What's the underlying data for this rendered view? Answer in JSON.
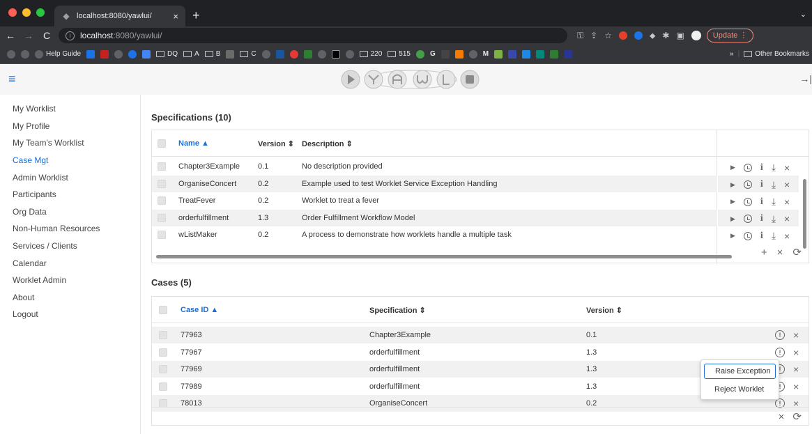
{
  "browser": {
    "tab_title": "localhost:8080/yawlui/",
    "tab_close": "×",
    "new_tab": "+",
    "url_host": "localhost",
    "url_path": ":8080/yawlui/",
    "update_label": "Update",
    "bookmarks": [
      {
        "label": "Help Guide",
        "kind": "site"
      },
      {
        "label": "DQ",
        "kind": "folder"
      },
      {
        "label": "A",
        "kind": "folder"
      },
      {
        "label": "B",
        "kind": "folder"
      },
      {
        "label": "C",
        "kind": "folder"
      },
      {
        "label": "220",
        "kind": "folder"
      },
      {
        "label": "515",
        "kind": "folder"
      },
      {
        "label": "G",
        "kind": "site"
      },
      {
        "label": "M",
        "kind": "site"
      }
    ],
    "bookmarks_overflow": "»",
    "other_bookmarks": "Other Bookmarks"
  },
  "sidebar": {
    "items": [
      {
        "label": "My Worklist",
        "active": false
      },
      {
        "label": "My Profile",
        "active": false
      },
      {
        "label": "My Team's Worklist",
        "active": false
      },
      {
        "label": "Case Mgt",
        "active": true
      },
      {
        "label": "Admin Worklist",
        "active": false
      },
      {
        "label": "Participants",
        "active": false
      },
      {
        "label": "Org Data",
        "active": false
      },
      {
        "label": "Non-Human Resources",
        "active": false
      },
      {
        "label": "Services / Clients",
        "active": false
      },
      {
        "label": "Calendar",
        "active": false
      },
      {
        "label": "Worklet Admin",
        "active": false
      },
      {
        "label": "About",
        "active": false
      },
      {
        "label": "Logout",
        "active": false
      }
    ]
  },
  "specifications": {
    "title": "Specifications (10)",
    "columns": {
      "name": "Name ▲",
      "version": "Version ⇕",
      "description": "Description ⇕"
    },
    "rows": [
      {
        "name": "Chapter3Example",
        "version": "0.1",
        "description": "No description provided"
      },
      {
        "name": "OrganiseConcert",
        "version": "0.2",
        "description": "Example used to test Worklet Service Exception Handling"
      },
      {
        "name": "TreatFever",
        "version": "0.2",
        "description": "Worklet to treat a fever"
      },
      {
        "name": "orderfulfillment",
        "version": "1.3",
        "description": "Order Fulfillment Workflow Model"
      },
      {
        "name": "wListMaker",
        "version": "0.2",
        "description": "A process to demonstrate how worklets handle a multiple task"
      }
    ],
    "footer_actions": {
      "add": "+",
      "remove": "×",
      "refresh": "⟳"
    }
  },
  "cases": {
    "title": "Cases (5)",
    "columns": {
      "case_id": "Case ID ▲",
      "specification": "Specification ⇕",
      "version": "Version ⇕"
    },
    "rows": [
      {
        "case_id": "77963",
        "specification": "Chapter3Example",
        "version": "0.1"
      },
      {
        "case_id": "77967",
        "specification": "orderfulfillment",
        "version": "1.3"
      },
      {
        "case_id": "77969",
        "specification": "orderfulfillment",
        "version": "1.3"
      },
      {
        "case_id": "77989",
        "specification": "orderfulfillment",
        "version": "1.3"
      },
      {
        "case_id": "78013",
        "specification": "OrganiseConcert",
        "version": "0.2"
      }
    ],
    "footer_actions": {
      "remove": "×",
      "refresh": "⟳"
    }
  },
  "context_menu": {
    "items": [
      "Raise Exception",
      "Reject Worklet"
    ]
  },
  "colors": {
    "accent": "#1a6fd6",
    "chrome_bg": "#202124",
    "header_bg": "#f6f6f6"
  }
}
